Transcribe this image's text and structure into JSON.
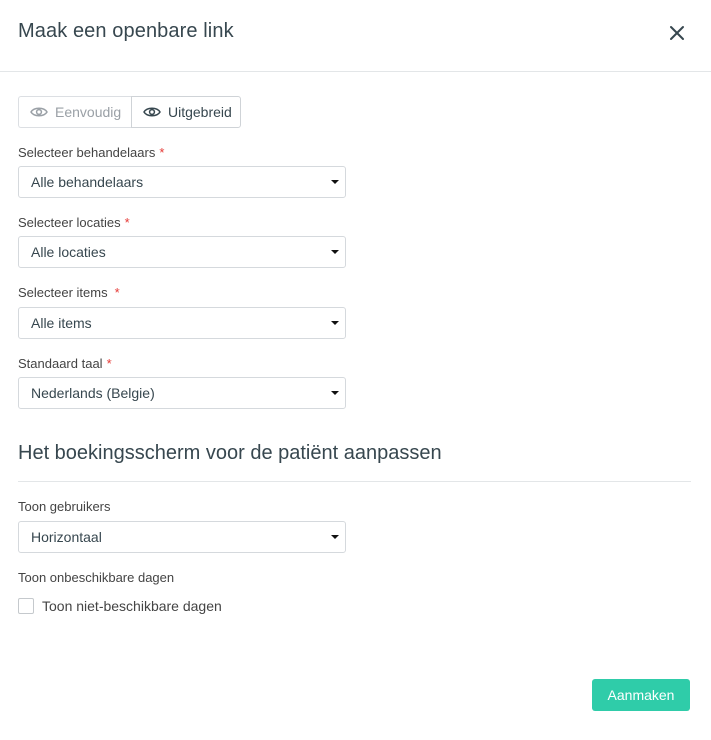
{
  "modal": {
    "title": "Maak een openbare link",
    "close_icon": "close-icon"
  },
  "view_toggle": {
    "simple_label": "Eenvoudig",
    "advanced_label": "Uitgebreid",
    "selected": "Uitgebreid",
    "icon": "eye-icon"
  },
  "fields": {
    "practitioners": {
      "label": "Selecteer behandelaars",
      "required_mark": "*",
      "value": "Alle behandelaars"
    },
    "locations": {
      "label": "Selecteer locaties",
      "required_mark": "*",
      "value": "Alle locaties"
    },
    "items": {
      "label": "Selecteer items",
      "required_mark": "*",
      "value": "Alle items"
    },
    "language": {
      "label": "Standaard taal",
      "required_mark": "*",
      "value": "Nederlands (Belgie)"
    }
  },
  "booking_section": {
    "title": "Het boekingsscherm voor de patiënt aanpassen",
    "show_users": {
      "label": "Toon gebruikers",
      "value": "Horizontaal"
    },
    "unavailable_days": {
      "label": "Toon onbeschikbare dagen",
      "checkbox_label": "Toon niet-beschikbare dagen",
      "checked": false
    }
  },
  "footer": {
    "submit_label": "Aanmaken"
  },
  "colors": {
    "accent": "#2fcca9",
    "required": "#e53935",
    "title_text": "#37474f"
  }
}
